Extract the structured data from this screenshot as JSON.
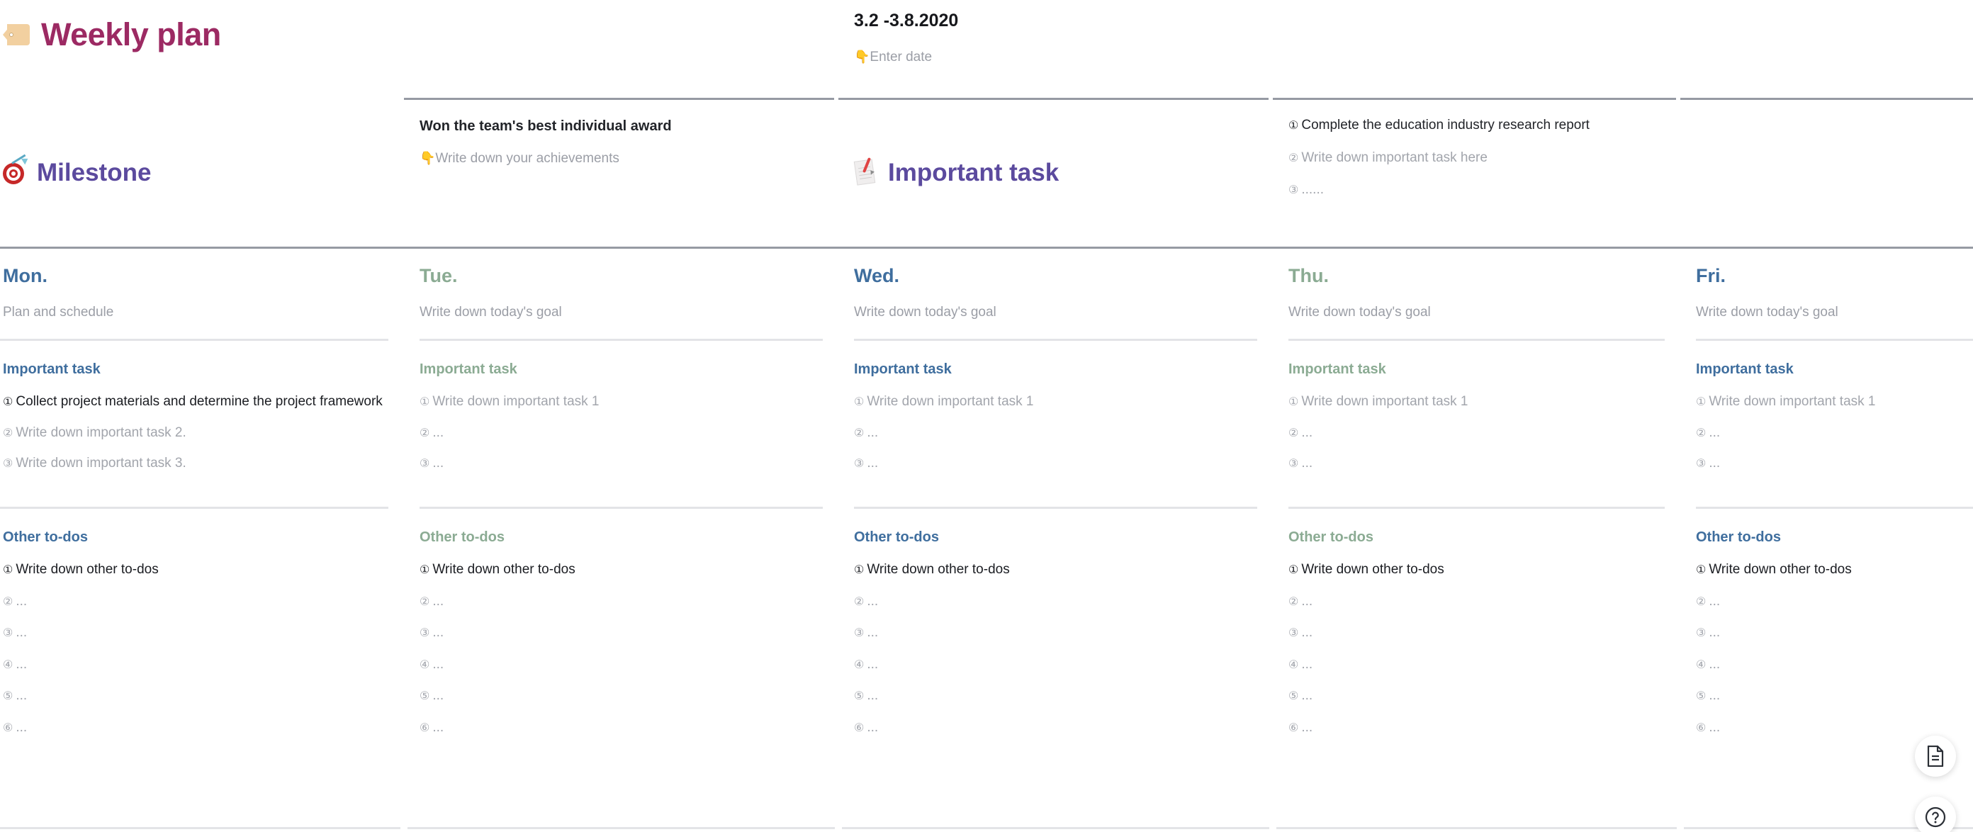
{
  "header": {
    "title": "Weekly plan",
    "tag_icon": "tag-icon",
    "date_value": "3.2 -3.8.2020",
    "date_hint": "Enter date",
    "hand_glyph": "👇"
  },
  "milestone": {
    "label": "Milestone",
    "icon": "target-icon",
    "achievement": "Won the team's best individual award",
    "achievement_hint": "Write down your achievements"
  },
  "important_task": {
    "label": "Important task",
    "icon": "memo-icon",
    "items": [
      {
        "num": "①",
        "text": "Complete the education industry research report",
        "filled": true
      },
      {
        "num": "②",
        "text": "Write down important task here",
        "filled": false
      },
      {
        "num": "③",
        "text": "......",
        "filled": false
      }
    ]
  },
  "section_titles": {
    "important_task": "Important task",
    "other_todos": "Other to-dos"
  },
  "colors": {
    "title": "#9c2a63",
    "purple": "#5b4a9e",
    "blue": "#3f6e9e",
    "green": "#8bab93",
    "muted": "#9b9ea6",
    "dark": "#1b1d22",
    "rule_dark": "#969aa3",
    "rule_light": "#e3e4e7"
  },
  "days": [
    {
      "name": "Mon.",
      "accent": "blue",
      "goal": "Plan and schedule",
      "goal_filled": false,
      "important": [
        {
          "num": "①",
          "text": "Collect project materials and determine the project framework",
          "filled": true
        },
        {
          "num": "②",
          "text": "Write down important task 2.",
          "filled": false
        },
        {
          "num": "③",
          "text": "Write down important task 3.",
          "filled": false
        }
      ],
      "todos": [
        {
          "num": "①",
          "text": "Write down other to-dos",
          "filled": true
        },
        {
          "num": "②",
          "text": "...",
          "filled": false
        },
        {
          "num": "③",
          "text": "...",
          "filled": false
        },
        {
          "num": "④",
          "text": "...",
          "filled": false
        },
        {
          "num": "⑤",
          "text": "...",
          "filled": false
        },
        {
          "num": "⑥",
          "text": "...",
          "filled": false
        }
      ]
    },
    {
      "name": "Tue.",
      "accent": "green",
      "goal": "Write down today's goal",
      "goal_filled": false,
      "important": [
        {
          "num": "①",
          "text": "Write down important task 1",
          "filled": false
        },
        {
          "num": "②",
          "text": "...",
          "filled": false
        },
        {
          "num": "③",
          "text": "...",
          "filled": false
        }
      ],
      "todos": [
        {
          "num": "①",
          "text": "Write down other to-dos",
          "filled": true
        },
        {
          "num": "②",
          "text": "...",
          "filled": false
        },
        {
          "num": "③",
          "text": "...",
          "filled": false
        },
        {
          "num": "④",
          "text": "...",
          "filled": false
        },
        {
          "num": "⑤",
          "text": "...",
          "filled": false
        },
        {
          "num": "⑥",
          "text": "...",
          "filled": false
        }
      ]
    },
    {
      "name": "Wed.",
      "accent": "blue",
      "goal": "Write down today's goal",
      "goal_filled": false,
      "important": [
        {
          "num": "①",
          "text": "Write down important task 1",
          "filled": false
        },
        {
          "num": "②",
          "text": "...",
          "filled": false
        },
        {
          "num": "③",
          "text": "...",
          "filled": false
        }
      ],
      "todos": [
        {
          "num": "①",
          "text": "Write down other to-dos",
          "filled": true
        },
        {
          "num": "②",
          "text": "...",
          "filled": false
        },
        {
          "num": "③",
          "text": "...",
          "filled": false
        },
        {
          "num": "④",
          "text": "...",
          "filled": false
        },
        {
          "num": "⑤",
          "text": "...",
          "filled": false
        },
        {
          "num": "⑥",
          "text": "...",
          "filled": false
        }
      ]
    },
    {
      "name": "Thu.",
      "accent": "green",
      "goal": "Write down today's goal",
      "goal_filled": false,
      "important": [
        {
          "num": "①",
          "text": "Write down important task 1",
          "filled": false
        },
        {
          "num": "②",
          "text": "...",
          "filled": false
        },
        {
          "num": "③",
          "text": "...",
          "filled": false
        }
      ],
      "todos": [
        {
          "num": "①",
          "text": "Write down other to-dos",
          "filled": true
        },
        {
          "num": "②",
          "text": "...",
          "filled": false
        },
        {
          "num": "③",
          "text": "...",
          "filled": false
        },
        {
          "num": "④",
          "text": "...",
          "filled": false
        },
        {
          "num": "⑤",
          "text": "...",
          "filled": false
        },
        {
          "num": "⑥",
          "text": "...",
          "filled": false
        }
      ]
    },
    {
      "name": "Fri.",
      "accent": "blue",
      "goal": "Write down today's goal",
      "goal_filled": false,
      "important": [
        {
          "num": "①",
          "text": "Write down important task 1",
          "filled": false
        },
        {
          "num": "②",
          "text": "...",
          "filled": false
        },
        {
          "num": "③",
          "text": "...",
          "filled": false
        }
      ],
      "todos": [
        {
          "num": "①",
          "text": "Write down other to-dos",
          "filled": true
        },
        {
          "num": "②",
          "text": "...",
          "filled": false
        },
        {
          "num": "③",
          "text": "...",
          "filled": false
        },
        {
          "num": "④",
          "text": "...",
          "filled": false
        },
        {
          "num": "⑤",
          "text": "...",
          "filled": false
        },
        {
          "num": "⑥",
          "text": "...",
          "filled": false
        }
      ]
    }
  ],
  "fab": {
    "doc_label": "document-icon",
    "help_label": "help-icon"
  }
}
